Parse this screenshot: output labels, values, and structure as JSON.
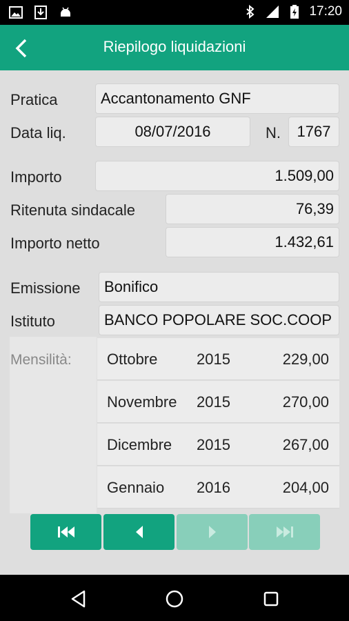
{
  "status_bar": {
    "time": "17:20"
  },
  "app_bar": {
    "title": "Riepilogo liquidazioni"
  },
  "form": {
    "pratica_label": "Pratica",
    "pratica_value": "Accantonamento GNF",
    "data_label": "Data liq.",
    "data_value": "08/07/2016",
    "n_label": "N.",
    "n_value": "1767",
    "importo_label": "Importo",
    "importo_value": "1.509,00",
    "ritenuta_label": "Ritenuta sindacale",
    "ritenuta_value": "76,39",
    "netto_label": "Importo netto",
    "netto_value": "1.432,61",
    "emissione_label": "Emissione",
    "emissione_value": "Bonifico",
    "istituto_label": "Istituto",
    "istituto_value": "BANCO POPOLARE SOC.COOP"
  },
  "mensilita": {
    "label": "Mensilità:",
    "rows": [
      {
        "month": "Ottobre",
        "year": "2015",
        "amount": "229,00"
      },
      {
        "month": "Novembre",
        "year": "2015",
        "amount": "270,00"
      },
      {
        "month": "Dicembre",
        "year": "2015",
        "amount": "267,00"
      },
      {
        "month": "Gennaio",
        "year": "2016",
        "amount": "204,00"
      }
    ]
  },
  "nav_buttons": {
    "first": {
      "icon": "skip-first-icon",
      "enabled": true
    },
    "prev": {
      "icon": "prev-icon",
      "enabled": true
    },
    "next": {
      "icon": "next-icon",
      "enabled": false
    },
    "last": {
      "icon": "skip-last-icon",
      "enabled": false
    }
  },
  "colors": {
    "accent": "#12a37f",
    "accent_disabled": "#88cfba",
    "background": "#dedede",
    "field": "#ececec"
  }
}
